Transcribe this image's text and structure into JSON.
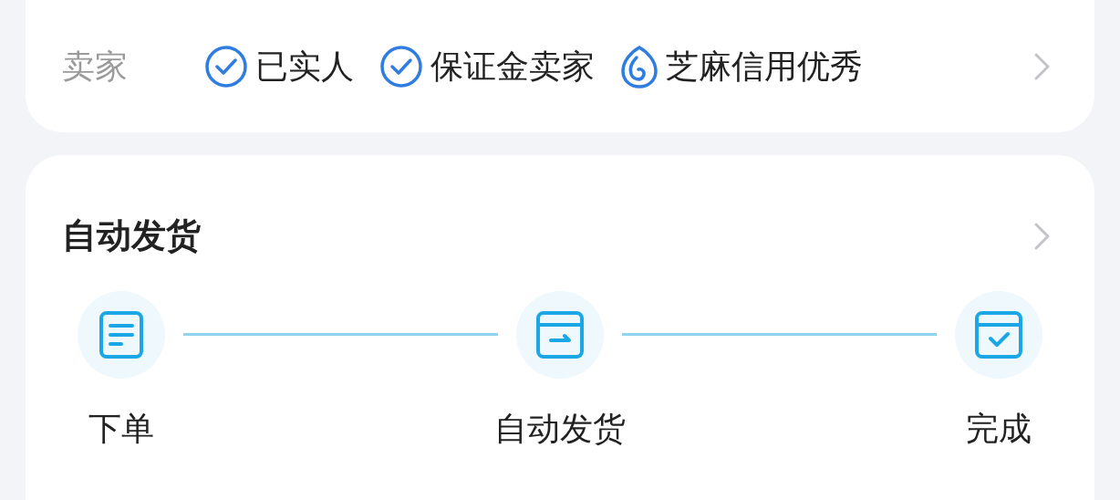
{
  "seller": {
    "label": "卖家",
    "badges": [
      {
        "kind": "verified",
        "text": "已实人"
      },
      {
        "kind": "verified",
        "text": "保证金卖家"
      },
      {
        "kind": "credit",
        "text": "芝麻信用优秀"
      }
    ]
  },
  "delivery": {
    "title": "自动发货",
    "steps": [
      {
        "kind": "order",
        "label": "下单"
      },
      {
        "kind": "ship",
        "label": "自动发货"
      },
      {
        "kind": "done",
        "label": "完成"
      }
    ]
  }
}
